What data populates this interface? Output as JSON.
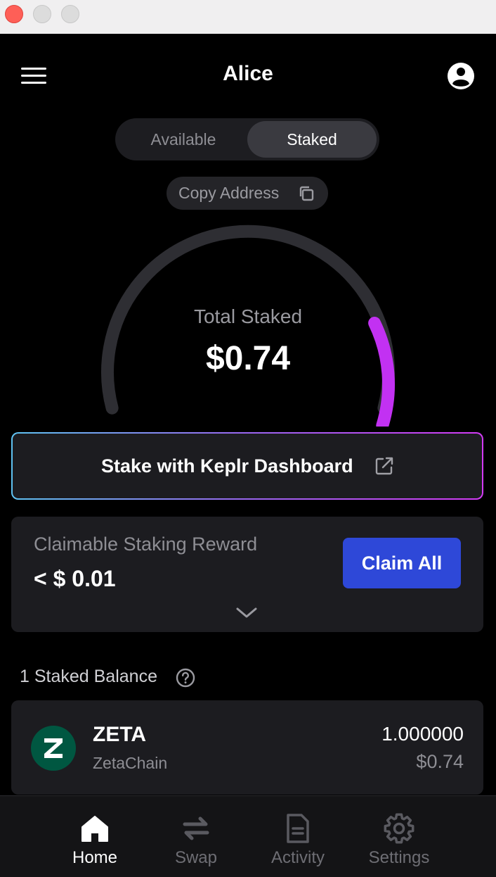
{
  "window": {
    "controls": [
      "close",
      "minimize",
      "zoom"
    ]
  },
  "header": {
    "title": "Alice",
    "menu_icon": "hamburger-icon",
    "profile_icon": "user-circle-icon"
  },
  "tabs": {
    "available_label": "Available",
    "staked_label": "Staked",
    "selected": "Staked"
  },
  "copy_address": {
    "label": "Copy Address",
    "icon": "copy-icon"
  },
  "gauge": {
    "label": "Total Staked",
    "value": "$0.74",
    "staked_fraction": 0.2,
    "track_color": "#2e2e33",
    "fill_color": "#c231f2"
  },
  "keplr_dashboard": {
    "label": "Stake with Keplr Dashboard",
    "icon": "external-link-icon"
  },
  "reward": {
    "label": "Claimable Staking Reward",
    "value": "< $ 0.01",
    "claim_label": "Claim All",
    "expand_icon": "chevron-down-icon"
  },
  "staked_balance": {
    "title": "1 Staked Balance",
    "help_icon": "help-circle-icon",
    "items": [
      {
        "symbol": "ZETA",
        "chain": "ZetaChain",
        "amount": "1.000000",
        "value": "$0.74",
        "logo_color": "#005741"
      }
    ]
  },
  "nav": {
    "items": [
      {
        "label": "Home",
        "icon": "home-icon",
        "active": true
      },
      {
        "label": "Swap",
        "icon": "swap-icon",
        "active": false
      },
      {
        "label": "Activity",
        "icon": "document-icon",
        "active": false
      },
      {
        "label": "Settings",
        "icon": "gear-icon",
        "active": false
      }
    ]
  },
  "colors": {
    "accent_blue": "#2e48d8",
    "accent_purple": "#c231f2",
    "background": "#000000",
    "card": "#1c1c20"
  }
}
